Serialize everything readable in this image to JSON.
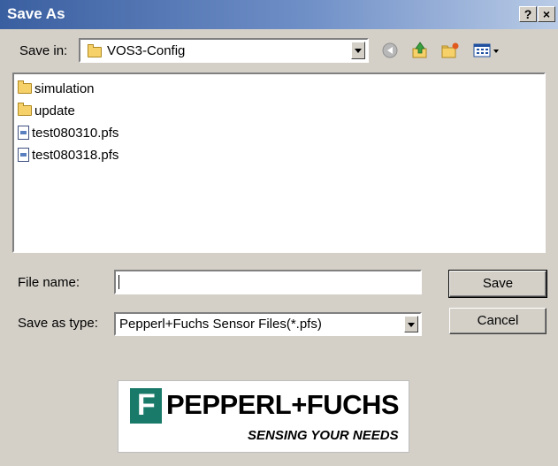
{
  "window": {
    "title": "Save As",
    "help_label": "?",
    "close_label": "×"
  },
  "toolbar": {
    "save_in_label": "Save in:",
    "save_in_value": "VOS3-Config"
  },
  "files": [
    {
      "name": "simulation",
      "type": "folder",
      "icon": "folder-icon"
    },
    {
      "name": "update",
      "type": "folder",
      "icon": "folder-icon"
    },
    {
      "name": "test080310.pfs",
      "type": "file",
      "icon": "pfs-file-icon"
    },
    {
      "name": "test080318.pfs",
      "type": "file",
      "icon": "pfs-file-icon"
    }
  ],
  "form": {
    "file_name_label": "File name:",
    "file_name_value": "",
    "save_type_label": "Save as type:",
    "save_type_value": "Pepperl+Fuchs Sensor Files(*.pfs)"
  },
  "buttons": {
    "save": "Save",
    "cancel": "Cancel"
  },
  "logo": {
    "brand": "PEPPERL+FUCHS",
    "tagline": "SENSING YOUR NEEDS",
    "mark_letter": "F",
    "brand_color": "#1a7a6a"
  }
}
